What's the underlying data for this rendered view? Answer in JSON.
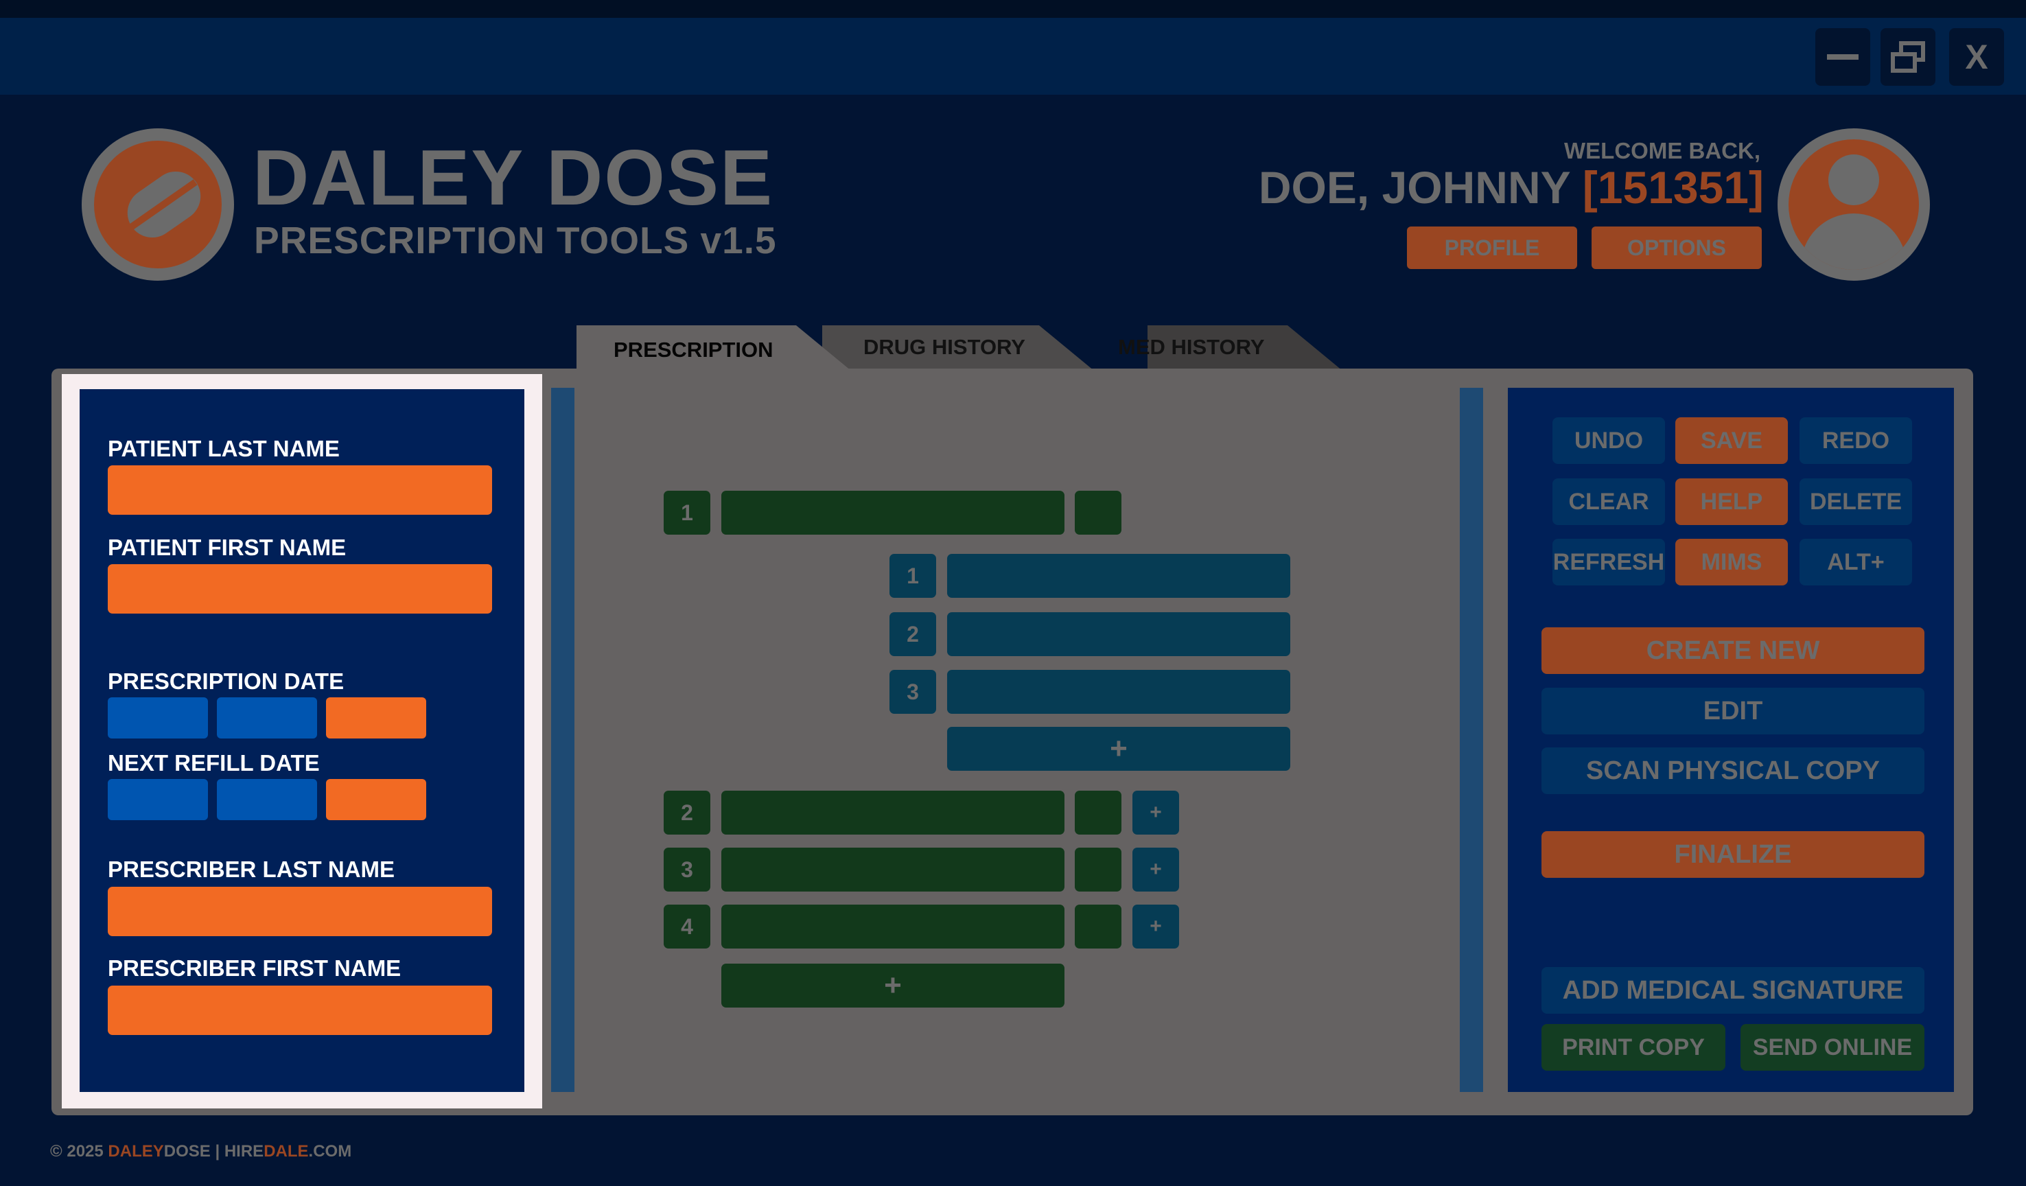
{
  "window": {
    "minimize_icon": "minimize-icon",
    "restore_icon": "restore-icon",
    "close_label": "X"
  },
  "header": {
    "brand_title": "DALEY DOSE",
    "brand_subtitle": "PRESCRIPTION TOOLS v1.5",
    "welcome_label": "WELCOME BACK,",
    "user_name": "DOE, JOHNNY",
    "user_id": "[151351]",
    "profile_label": "PROFILE",
    "options_label": "OPTIONS"
  },
  "tabs": [
    {
      "label": "PRESCRIPTION",
      "active": true
    },
    {
      "label": "DRUG HISTORY",
      "active": false
    },
    {
      "label": "MED HISTORY",
      "active": false
    }
  ],
  "form": {
    "patient_last_name_label": "PATIENT LAST NAME",
    "patient_first_name_label": "PATIENT FIRST NAME",
    "prescription_date_label": "PRESCRIPTION DATE",
    "next_refill_date_label": "NEXT REFILL DATE",
    "prescriber_last_name_label": "PRESCRIBER LAST NAME",
    "prescriber_first_name_label": "PRESCRIBER FIRST NAME"
  },
  "prescription_items": {
    "item_numbers": [
      "1",
      "2",
      "3",
      "4"
    ],
    "sub_numbers": [
      "1",
      "2",
      "3"
    ],
    "add_label": "+",
    "add_small_label": "+"
  },
  "tools": {
    "undo": "UNDO",
    "save": "SAVE",
    "redo": "REDO",
    "clear": "CLEAR",
    "help": "HELP",
    "delete": "DELETE",
    "refresh": "REFRESH",
    "mims": "MIMS",
    "alt": "ALT+",
    "create_new": "CREATE NEW",
    "edit": "EDIT",
    "scan": "SCAN PHYSICAL COPY",
    "finalize": "FINALIZE",
    "add_signature": "ADD MEDICAL SIGNATURE",
    "print_copy": "PRINT COPY",
    "send_online": "SEND ONLINE"
  },
  "footer": {
    "copyright": "© 2025",
    "brand_a": "DALEY",
    "brand_b": "DOSE",
    "separator": "|",
    "site_a": "HIRE",
    "site_b": "DALE",
    "site_c": ".COM"
  },
  "colors": {
    "background": "#021433",
    "accent_rust": "#9a4622",
    "input_orange": "#f26a23",
    "panel_gray": "#656262",
    "panel_navy": "#002058"
  }
}
